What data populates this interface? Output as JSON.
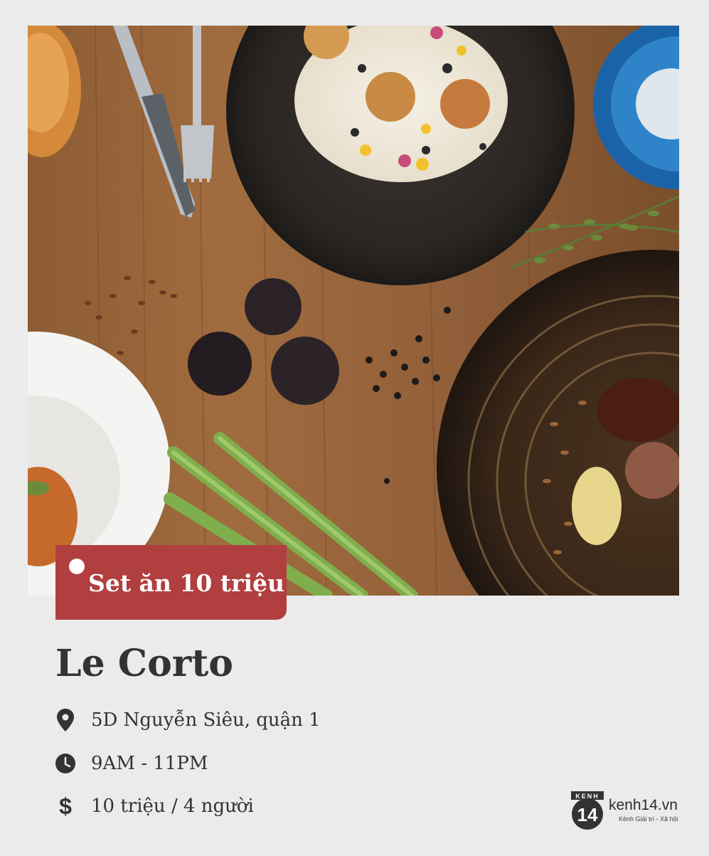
{
  "badge": {
    "label": "Set ăn 10 triệu"
  },
  "restaurant": {
    "name": "Le Corto",
    "address": "5D Nguyễn Siêu, quận 1",
    "hours": "9AM - 11PM",
    "price": "10 triệu / 4 người"
  },
  "icons": {
    "address": "location-pin-icon",
    "hours": "clock-icon",
    "price": "dollar-icon"
  },
  "brand": {
    "badge_top": "KENH",
    "badge_number": "14",
    "name": "kenh14.vn",
    "tagline": "Kênh Giải trí - Xã hội"
  },
  "colors": {
    "accent": "#b23f3f",
    "background": "#ebebeb",
    "text": "#333333"
  }
}
